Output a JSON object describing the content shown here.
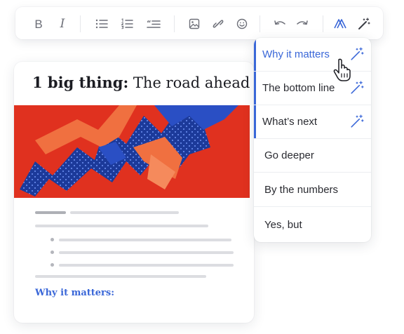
{
  "toolbar": {
    "bold_label": "B",
    "italic_label": "I",
    "icons": [
      "bullet-list-icon",
      "numbered-list-icon",
      "quote-icon",
      "image-icon",
      "link-icon",
      "emoji-icon",
      "undo-icon",
      "redo-icon",
      "brand-logo-icon",
      "magic-wand-icon"
    ],
    "accent": "#3a67d8"
  },
  "card": {
    "title_bold": "1 big thing:",
    "title_rest": " The road ahead",
    "section_label": "Why it matters:"
  },
  "menu": {
    "items": [
      {
        "label": "Why it matters",
        "state": "active",
        "icon": "magic-wand-icon"
      },
      {
        "label": "The bottom line",
        "state": "highlighted",
        "icon": "magic-wand-icon"
      },
      {
        "label": "What’s next",
        "state": "highlighted",
        "icon": "magic-wand-icon"
      },
      {
        "label": "Go deeper",
        "state": "normal"
      },
      {
        "label": "By the numbers",
        "state": "normal"
      },
      {
        "label": "Yes, but",
        "state": "normal"
      }
    ]
  },
  "colors": {
    "accent": "#3a67d8",
    "hero_red": "#e0311f",
    "arrow_orange": "#f07040",
    "arrow_blue": "#2a4fc4"
  }
}
